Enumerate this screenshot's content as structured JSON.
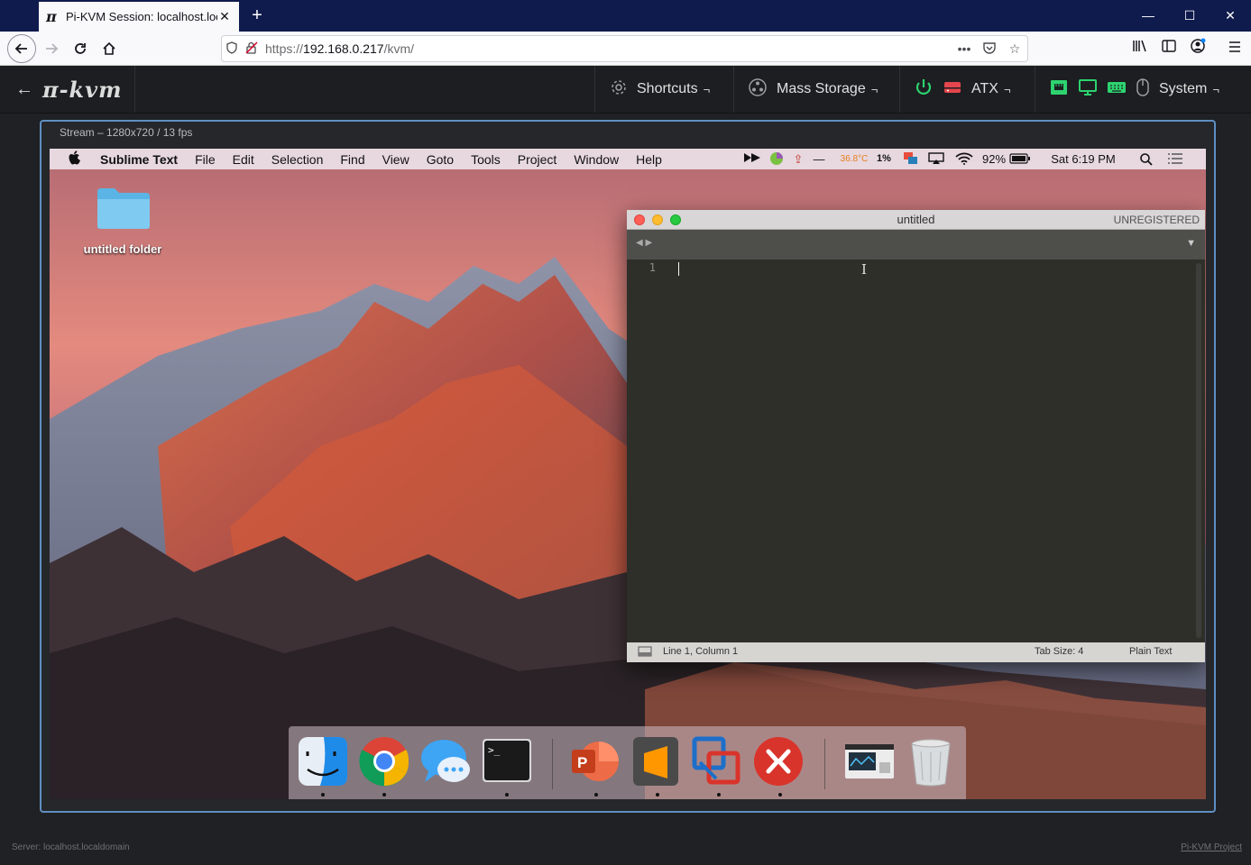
{
  "browser": {
    "tab": {
      "icon": "π",
      "title": "Pi-KVM Session: localhost.local",
      "close": "✕"
    },
    "new_tab": "+",
    "window_controls": {
      "minimize": "—",
      "maximize": "☐",
      "close": "✕"
    },
    "url": {
      "prefix": "https://",
      "host": "192.168.0.217",
      "path": "/kvm/"
    }
  },
  "kvm": {
    "back_arrow": "←",
    "brand": "π-kvm",
    "menus": [
      {
        "label": "Shortcuts",
        "arrow": "¬"
      },
      {
        "label": "Mass Storage",
        "arrow": "¬"
      },
      {
        "label": "ATX",
        "arrow": "¬"
      },
      {
        "label": "System",
        "arrow": "¬"
      }
    ],
    "stream_title": "Stream – 1280x720 / 13 fps",
    "footer_left": "Server: localhost.localdomain",
    "footer_right": "Pi-KVM Project",
    "colors": {
      "accent_green": "#2dd36f",
      "accent_red": "#e5454c",
      "stream_border": "#5f8fc2"
    }
  },
  "mac": {
    "menu": [
      "Sublime Text",
      "File",
      "Edit",
      "Selection",
      "Find",
      "View",
      "Goto",
      "Tools",
      "Project",
      "Window",
      "Help"
    ],
    "status": {
      "temp": "36.8°C",
      "cpu": "1%",
      "battery": "92%",
      "clock": "Sat 6:19 PM"
    },
    "desktop_folder": "untitled folder",
    "sublime": {
      "title": "untitled",
      "registered": "UNREGISTERED",
      "line_number": "1",
      "status_position": "Line 1, Column 1",
      "tab_size": "Tab Size: 4",
      "syntax": "Plain Text"
    },
    "dock": [
      "finder-icon",
      "chrome-icon",
      "messages-icon",
      "terminal-icon",
      "powerpoint-icon",
      "sublime-text-icon",
      "vmware-fusion-icon",
      "remote-desktop-icon",
      "preview-window-icon",
      "trash-icon"
    ]
  }
}
